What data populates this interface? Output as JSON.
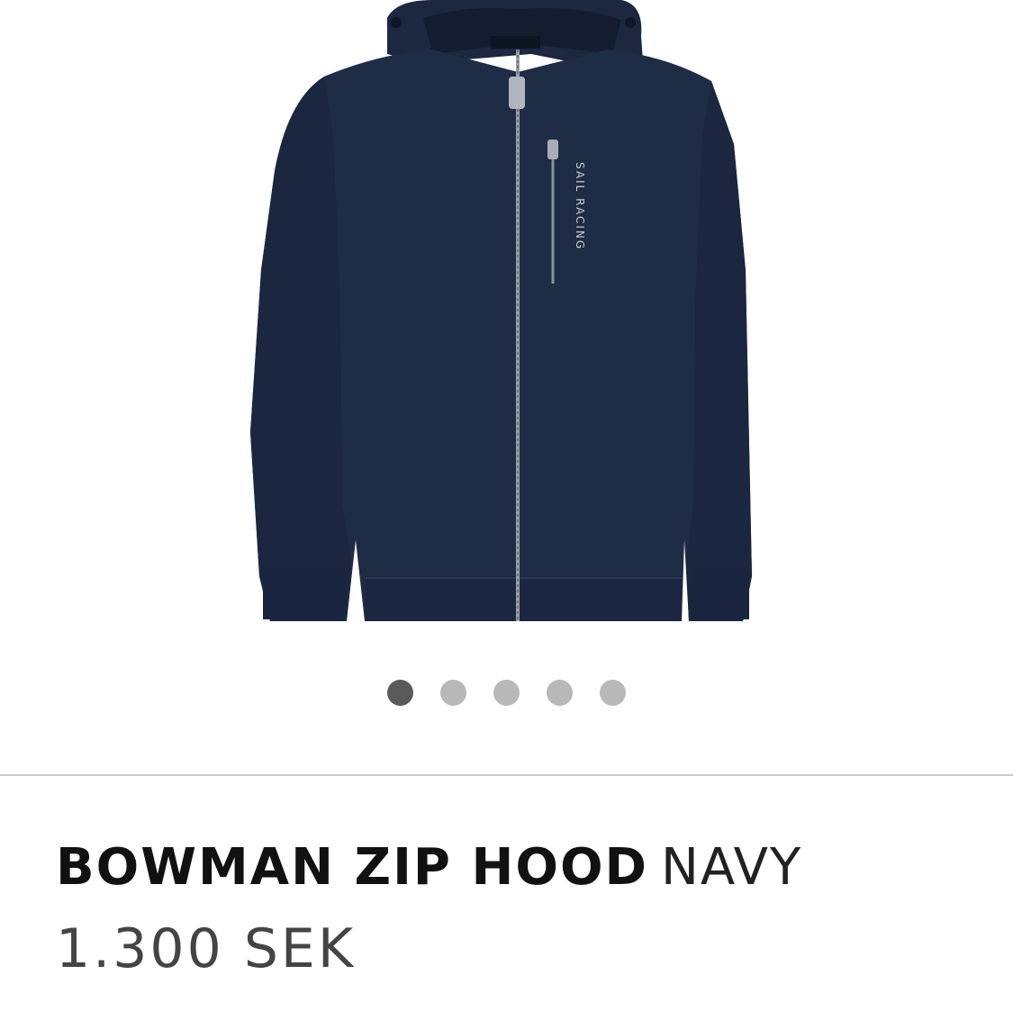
{
  "product": {
    "image_logo_text": "SAIL RACING",
    "name": "BOWMAN ZIP HOOD",
    "color": "NAVY",
    "price": "1.300 SEK"
  },
  "carousel": {
    "total": 5,
    "active_index": 0
  },
  "colors": {
    "garment": "#1f2c45",
    "dot_active": "#5a5a5a",
    "dot_inactive": "#b8b8b8",
    "divider": "#c8c8c8"
  }
}
